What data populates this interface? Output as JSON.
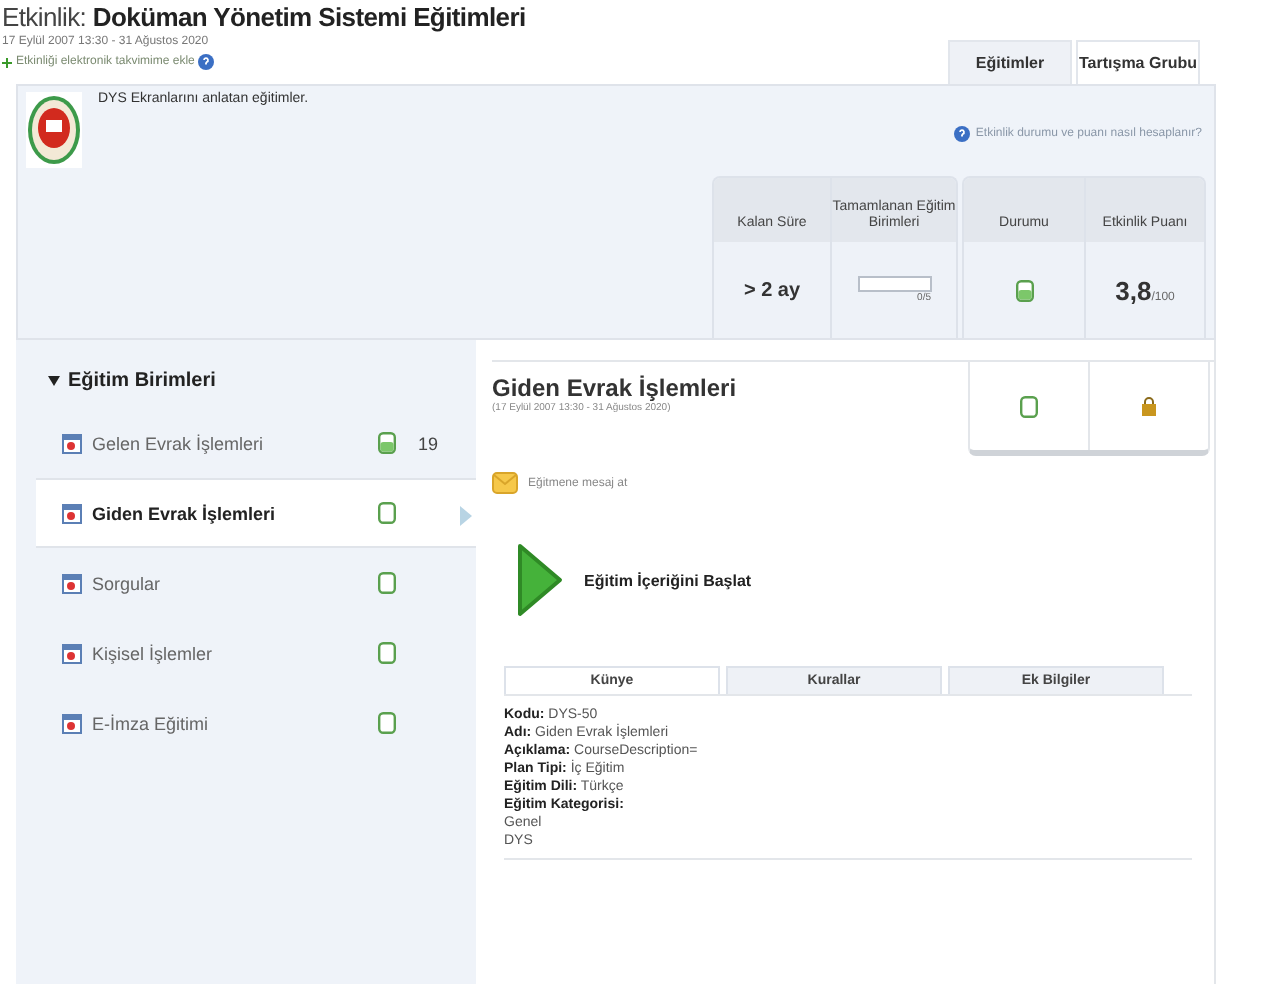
{
  "header": {
    "label": "Etkinlik:",
    "title": "Doküman Yönetim Sistemi Eğitimleri",
    "dates": "17 Eylül 2007 13:30 - 31 Ağustos 2020",
    "calendar_link": "Etkinliği elektronik takvimime ekle"
  },
  "tabs": [
    {
      "label": "Eğitimler",
      "selected": true
    },
    {
      "label": "Tartışma Grubu",
      "selected": false
    }
  ],
  "description": "DYS Ekranlarını anlatan eğitimler.",
  "help_link": "Etkinlik durumu ve puanı nasıl hesaplanır?",
  "stats": {
    "remaining_label": "Kalan Süre",
    "remaining": "> 2 ay",
    "completed_label": "Tamamlanan Eğitim Birimleri",
    "progress": {
      "level": 0,
      "reading": "0/5"
    },
    "status_label": "Durumu",
    "in_progress": true,
    "score_label": "Etkinlik Puanı",
    "score": "3,8",
    "score_max": "/100"
  },
  "sidebar": {
    "heading": "Eğitim Birimleri",
    "expanded": true,
    "items": [
      {
        "label": "Gelen Evrak İşlemleri",
        "in_progress": true,
        "count": "19",
        "selected": false
      },
      {
        "label": "Giden Evrak İşlemleri",
        "in_progress": false,
        "selected": true
      },
      {
        "label": "Sorgular",
        "in_progress": false,
        "selected": false
      },
      {
        "label": "Kişisel İşlemler",
        "in_progress": false,
        "selected": false
      },
      {
        "label": "E-İmza Eğitimi",
        "in_progress": false,
        "selected": false
      }
    ]
  },
  "unit": {
    "title": "Giden Evrak İşlemleri",
    "dates": "(17 Eylül 2007 13:30 - 31 Ağustos 2020)",
    "in_progress": false,
    "locked": true,
    "message_link": "Eğitmene mesaj at",
    "start_button": "Eğitim İçeriğini Başlat",
    "tabs": [
      {
        "label": "Künye",
        "selected": true
      },
      {
        "label": "Kurallar",
        "selected": false
      },
      {
        "label": "Ek Bilgiler",
        "selected": false
      }
    ],
    "fields": [
      {
        "label": "Kodu:",
        "value": "DYS-50"
      },
      {
        "label": "Adı:",
        "value": "Giden Evrak İşlemleri"
      },
      {
        "label": "Açıklama:",
        "value": "CourseDescription="
      },
      {
        "label": "Plan Tipi:",
        "value": "İç Eğitim"
      },
      {
        "label": "Eğitim Dili:",
        "value": "Türkçe"
      },
      {
        "label": "Eğitim Kategorisi:",
        "lines": [
          "Genel",
          "DYS"
        ]
      }
    ]
  }
}
